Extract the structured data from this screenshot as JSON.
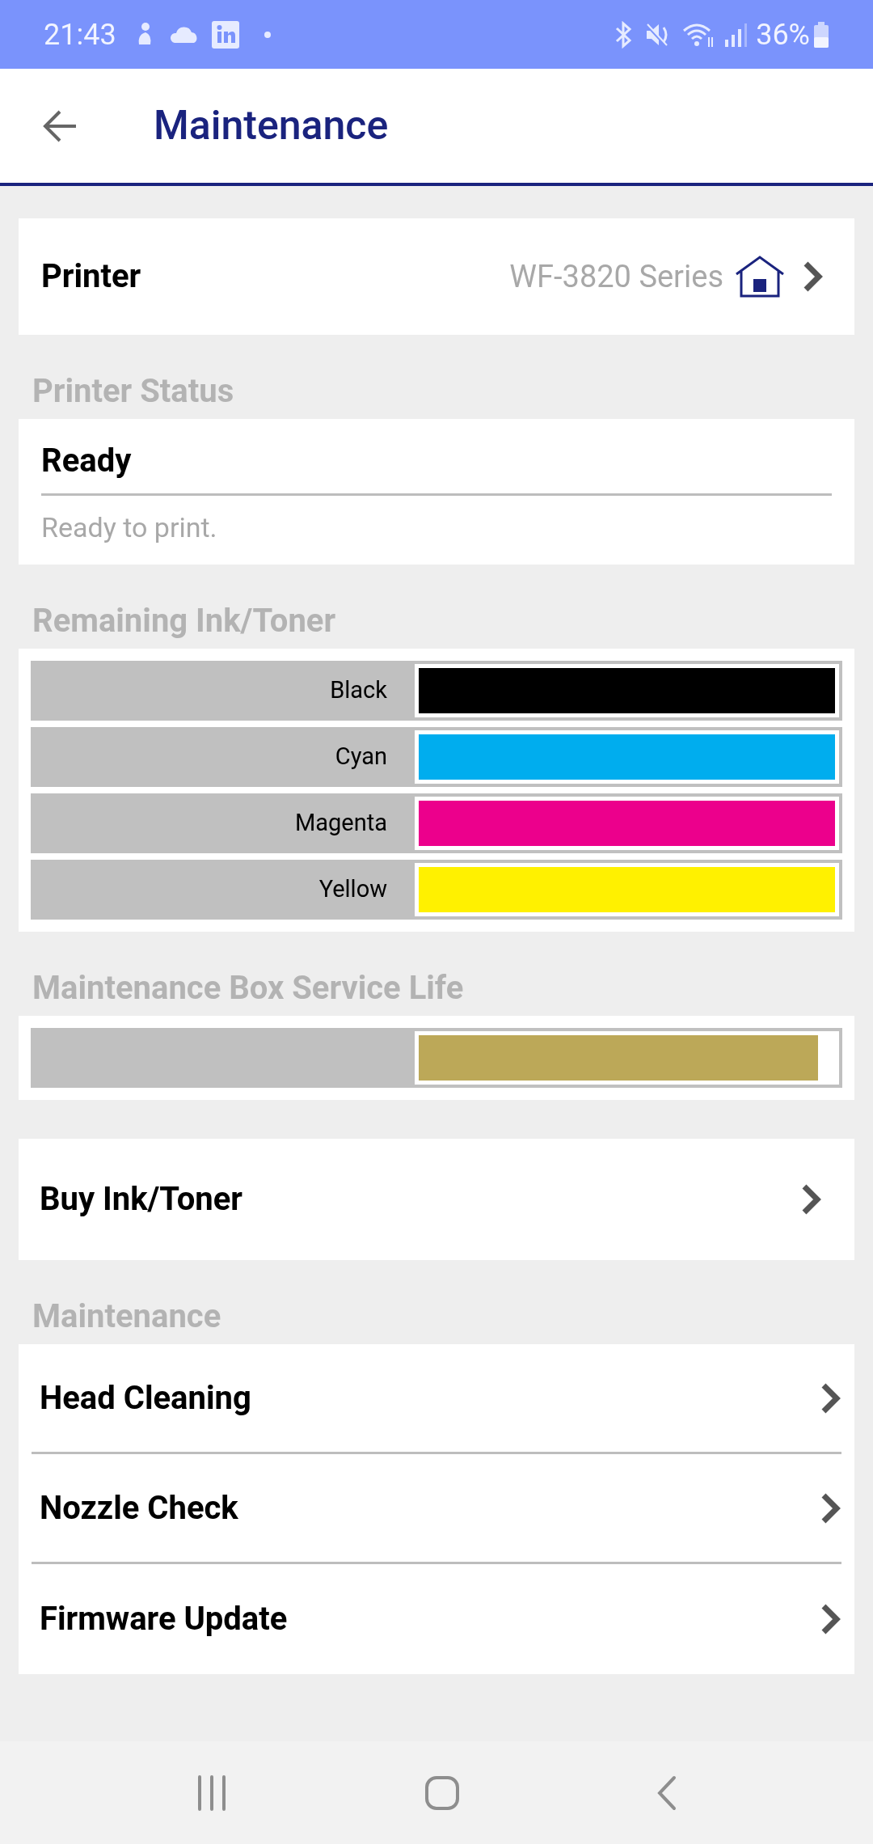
{
  "status_bar": {
    "time": "21:43",
    "battery": "36%"
  },
  "app_bar": {
    "title": "Maintenance"
  },
  "printer": {
    "label": "Printer",
    "value": "WF-3820 Series"
  },
  "printer_status": {
    "heading": "Printer Status",
    "state": "Ready",
    "message": "Ready to print."
  },
  "remaining_ink": {
    "heading": "Remaining Ink/Toner",
    "inks": [
      {
        "name": "Black",
        "color": "#000000",
        "level": 1
      },
      {
        "name": "Cyan",
        "color": "#00adee",
        "level": 1
      },
      {
        "name": "Magenta",
        "color": "#ec008c",
        "level": 1
      },
      {
        "name": "Yellow",
        "color": "#fff100",
        "level": 1
      }
    ]
  },
  "maintenance_box": {
    "heading": "Maintenance Box Service Life",
    "level": 0.96
  },
  "buy": {
    "label": "Buy Ink/Toner"
  },
  "maintenance": {
    "heading": "Maintenance",
    "items": [
      {
        "label": "Head Cleaning"
      },
      {
        "label": "Nozzle Check"
      },
      {
        "label": "Firmware Update"
      }
    ]
  }
}
